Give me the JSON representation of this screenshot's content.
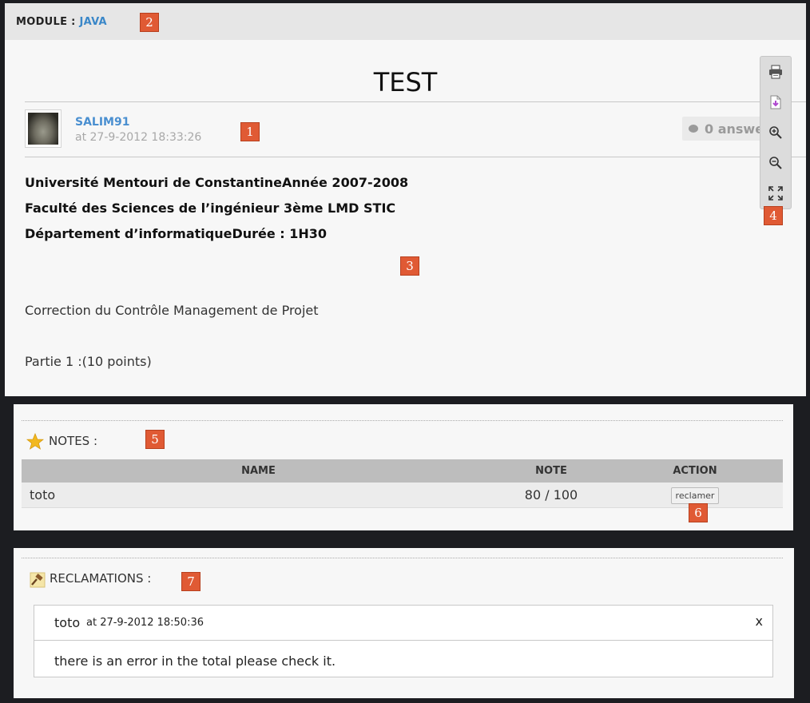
{
  "module": {
    "label": "MODULE :",
    "name": "JAVA"
  },
  "post": {
    "title": "TEST",
    "author": "SALIM91",
    "date": "at 27-9-2012 18:33:26",
    "answers": "0 answers",
    "lines": [
      "Université Mentouri de ConstantineAnnée 2007-2008",
      "Faculté des Sciences de l’ingénieur 3ème LMD STIC",
      "Département d’informatiqueDurée : 1H30"
    ],
    "paragraphs": [
      "Correction du Contrôle Management de Projet",
      "Partie 1 :(10 points)"
    ]
  },
  "toolbar": {
    "icons": [
      "print-icon",
      "download-pdf-icon",
      "zoom-in-icon",
      "zoom-out-icon",
      "fullscreen-icon"
    ]
  },
  "notes": {
    "title": "NOTES :",
    "headers": [
      "NAME",
      "NOTE",
      "ACTION"
    ],
    "rows": [
      {
        "name": "toto",
        "note": "80 / 100",
        "action": "reclamer"
      }
    ]
  },
  "reclamations": {
    "title": "RECLAMATIONS :",
    "items": [
      {
        "user": "toto",
        "date": "at 27-9-2012 18:50:36",
        "close": "x",
        "message": "there is an error in the total please check it."
      }
    ]
  },
  "badges": [
    "1",
    "2",
    "3",
    "4",
    "5",
    "6",
    "7"
  ],
  "colors": {
    "link": "#3a87c8",
    "badge": "#e05a34",
    "panel": "#f7f7f7",
    "background": "#1c1d21"
  }
}
